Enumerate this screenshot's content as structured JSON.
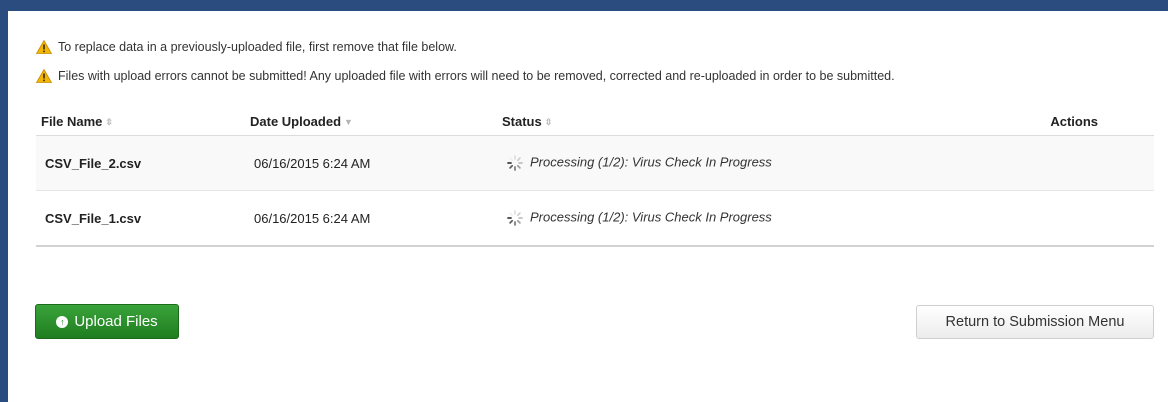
{
  "alerts": [
    {
      "icon": "warning-icon",
      "text": "To replace data in a previously-uploaded file, first remove that file below."
    },
    {
      "icon": "warning-icon",
      "text": "Files with upload errors cannot be submitted! Any uploaded file with errors will need to be removed, corrected and re-uploaded in order to be submitted."
    }
  ],
  "table": {
    "headers": {
      "file_name": "File Name",
      "date_uploaded": "Date Uploaded",
      "status": "Status",
      "actions": "Actions"
    },
    "rows": [
      {
        "file_name": "CSV_File_2.csv",
        "date_uploaded": "06/16/2015 6:24 AM",
        "status": "Processing (1/2): Virus Check In Progress"
      },
      {
        "file_name": "CSV_File_1.csv",
        "date_uploaded": "06/16/2015 6:24 AM",
        "status": "Processing (1/2): Virus Check In Progress"
      }
    ]
  },
  "buttons": {
    "upload_label": "Upload Files",
    "return_label": "Return to Submission Menu"
  },
  "colors": {
    "frame": "#2b4c7e",
    "upload_button": "#2e8b2e",
    "warning": "#f0b400"
  }
}
